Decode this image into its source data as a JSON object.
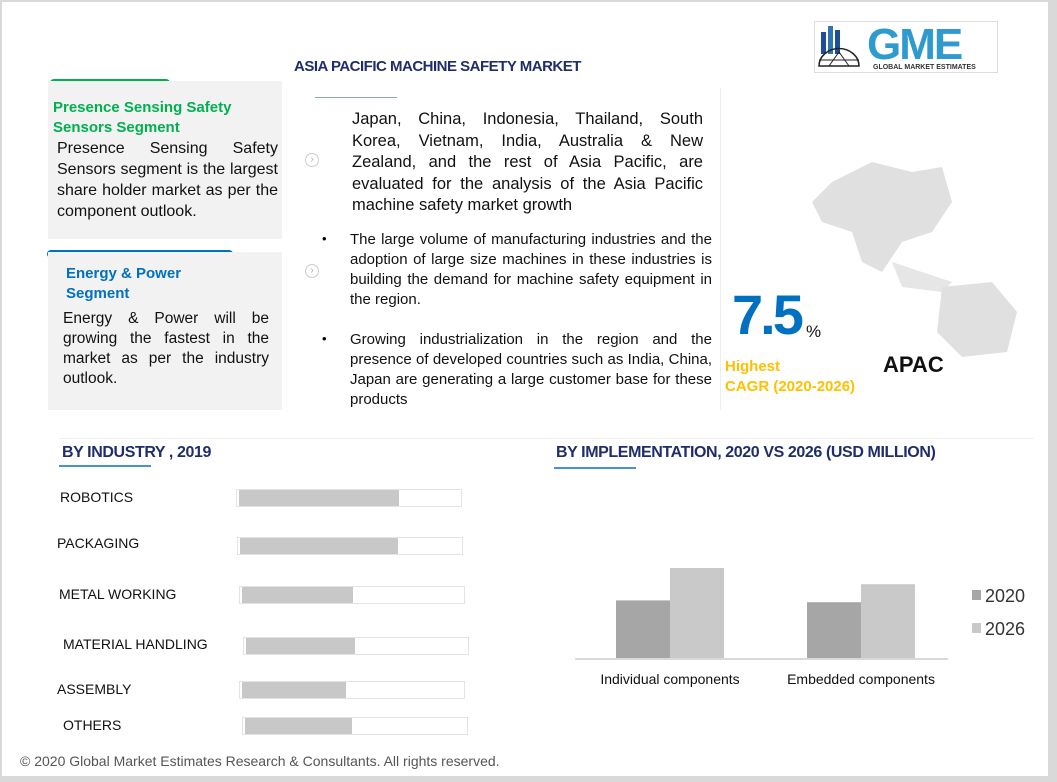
{
  "header": {
    "title": "ASIA PACIFIC MACHINE SAFETY MARKET",
    "logo_text": "GME",
    "logo_sub": "GLOBAL MARKET ESTIMATES"
  },
  "cards": [
    {
      "heading": "Presence Sensing Safety Sensors Segment",
      "body": "Presence Sensing Safety Sensors segment is the largest share holder market as per the component outlook.",
      "color": "#00b050"
    },
    {
      "heading": "Energy & Power Segment",
      "body": "Energy & Power will be growing the fastest in the market as per the industry outlook.",
      "color": "#0070c0"
    }
  ],
  "bullets": [
    "Japan, China, Indonesia, Thailand, South Korea, Vietnam, India, Australia & New Zealand, and the rest of Asia Pacific, are evaluated for the analysis of the Asia Pacific machine safety market growth",
    "The large volume of manufacturing industries and the adoption of large size machines in these industries is building the demand for machine safety equipment in the region.",
    "Growing industrialization in the region and the presence of developed countries such as India, China, Japan are generating a large customer base for these products"
  ],
  "bullet_glyph": "•",
  "stat": {
    "value": "7.5",
    "unit": "%",
    "label1": "Highest",
    "label2": "CAGR (2020-2026)",
    "region": "APAC",
    "value_color": "#0070c0",
    "label_color": "#ffc000"
  },
  "footer": "© 2020 Global Market Estimates Research & Consultants. All rights reserved.",
  "chart_data": [
    {
      "type": "bar",
      "orientation": "horizontal",
      "title": "BY INDUSTRY , 2019",
      "categories": [
        "ROBOTICS",
        "PACKAGING",
        "METAL WORKING",
        "MATERIAL HANDLING",
        "ASSEMBLY",
        "OTHERS"
      ],
      "values": [
        0.72,
        0.71,
        0.5,
        0.49,
        0.47,
        0.48
      ],
      "xlim": [
        0,
        1
      ],
      "color": "#c8c8c8"
    },
    {
      "type": "bar",
      "title": "BY IMPLEMENTATION,  2020 VS 2026 (USD MILLION)",
      "categories": [
        "Individual components",
        "Embedded components"
      ],
      "series": [
        {
          "name": "2020",
          "values": [
            0.64,
            0.62
          ],
          "color": "#a6a6a6"
        },
        {
          "name": "2026",
          "values": [
            1.0,
            0.82
          ],
          "color": "#c9c9c9"
        }
      ],
      "ylim": [
        0,
        1
      ],
      "legend": "right",
      "grid": false
    }
  ]
}
